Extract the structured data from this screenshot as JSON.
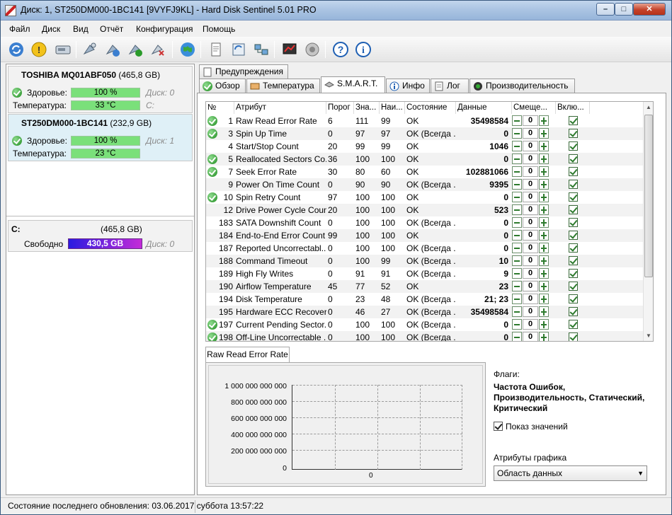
{
  "window": {
    "title": "Диск: 1, ST250DM000-1BC141 [9VYFJ9KL]  -  Hard Disk Sentinel 5.01 PRO",
    "min": "–",
    "max": "□",
    "close": "✕"
  },
  "menu": [
    "Файл",
    "Диск",
    "Вид",
    "Отчёт",
    "Конфигурация",
    "Помощь"
  ],
  "toolbar": [
    {
      "icon": "refresh-icon"
    },
    {
      "icon": "warning-icon"
    },
    {
      "icon": "drive-icon"
    },
    {
      "icon": "satellite-icon"
    },
    {
      "icon": "satellite-refresh-icon"
    },
    {
      "icon": "satellite-check-icon"
    },
    {
      "icon": "satellite-x-icon"
    },
    {
      "icon": "globe-icon"
    },
    {
      "icon": "report-icon"
    },
    {
      "icon": "sync-icon"
    },
    {
      "icon": "network-icon"
    },
    {
      "icon": "chart-icon"
    },
    {
      "icon": "speaker-icon"
    },
    {
      "icon": "help-icon"
    },
    {
      "icon": "info-icon"
    }
  ],
  "disks": [
    {
      "model": "TOSHIBA MQ01ABF050",
      "size": "(465,8 GB)",
      "health_label": "Здоровье:",
      "health": "100 %",
      "health_note": "Диск: 0",
      "temp_label": "Температура:",
      "temp": "33 °C",
      "temp_note": "C:"
    },
    {
      "model": "ST250DM000-1BC141",
      "size": "(232,9 GB)",
      "health_label": "Здоровье:",
      "health": "100 %",
      "health_note": "Диск: 1",
      "temp_label": "Температура:",
      "temp": "23 °C",
      "temp_note": ""
    }
  ],
  "volume": {
    "name": "C:",
    "size": "(465,8 GB)",
    "free_label": "Свободно",
    "free": "430,5 GB",
    "note": "Диск: 0"
  },
  "tabs_top": [
    {
      "label": "Предупреждения"
    }
  ],
  "tabs": [
    {
      "label": "Обзор",
      "icon": "check-icon"
    },
    {
      "label": "Температура",
      "icon": "thermometer-icon"
    },
    {
      "label": "S.M.A.R.T.",
      "icon": "smart-icon"
    },
    {
      "label": "Инфо",
      "icon": "info-icon"
    },
    {
      "label": "Лог",
      "icon": "log-icon"
    },
    {
      "label": "Производительность",
      "icon": "gauge-icon"
    }
  ],
  "smart": {
    "columns": [
      "№",
      "Атрибут",
      "Порог",
      "Зна...",
      "Наи...",
      "Состояние",
      "Данные",
      "Смеще...",
      "Вклю..."
    ],
    "rows": [
      {
        "ok": true,
        "num": "1",
        "attr": "Raw Read Error Rate",
        "thr": "6",
        "val": "111",
        "worst": "99",
        "state": "OK",
        "data": "35498584",
        "offset": "0"
      },
      {
        "ok": true,
        "num": "3",
        "attr": "Spin Up Time",
        "thr": "0",
        "val": "97",
        "worst": "97",
        "state": "OK (Всегда ...",
        "data": "0",
        "offset": "0"
      },
      {
        "ok": false,
        "num": "4",
        "attr": "Start/Stop Count",
        "thr": "20",
        "val": "99",
        "worst": "99",
        "state": "OK",
        "data": "1046",
        "offset": "0"
      },
      {
        "ok": true,
        "num": "5",
        "attr": "Reallocated Sectors Co...",
        "thr": "36",
        "val": "100",
        "worst": "100",
        "state": "OK",
        "data": "0",
        "offset": "0"
      },
      {
        "ok": true,
        "num": "7",
        "attr": "Seek Error Rate",
        "thr": "30",
        "val": "80",
        "worst": "60",
        "state": "OK",
        "data": "102881066",
        "offset": "0"
      },
      {
        "ok": false,
        "num": "9",
        "attr": "Power On Time Count",
        "thr": "0",
        "val": "90",
        "worst": "90",
        "state": "OK (Всегда ...",
        "data": "9395",
        "offset": "0"
      },
      {
        "ok": true,
        "num": "10",
        "attr": "Spin Retry Count",
        "thr": "97",
        "val": "100",
        "worst": "100",
        "state": "OK",
        "data": "0",
        "offset": "0"
      },
      {
        "ok": false,
        "num": "12",
        "attr": "Drive Power Cycle Count",
        "thr": "20",
        "val": "100",
        "worst": "100",
        "state": "OK",
        "data": "523",
        "offset": "0"
      },
      {
        "ok": false,
        "num": "183",
        "attr": "SATA Downshift Count",
        "thr": "0",
        "val": "100",
        "worst": "100",
        "state": "OK (Всегда ...",
        "data": "0",
        "offset": "0"
      },
      {
        "ok": false,
        "num": "184",
        "attr": "End-to-End Error Count",
        "thr": "99",
        "val": "100",
        "worst": "100",
        "state": "OK",
        "data": "0",
        "offset": "0"
      },
      {
        "ok": false,
        "num": "187",
        "attr": "Reported Uncorrectabl...",
        "thr": "0",
        "val": "100",
        "worst": "100",
        "state": "OK (Всегда ...",
        "data": "0",
        "offset": "0"
      },
      {
        "ok": false,
        "num": "188",
        "attr": "Command Timeout",
        "thr": "0",
        "val": "100",
        "worst": "99",
        "state": "OK (Всегда ...",
        "data": "10",
        "offset": "0"
      },
      {
        "ok": false,
        "num": "189",
        "attr": "High Fly Writes",
        "thr": "0",
        "val": "91",
        "worst": "91",
        "state": "OK (Всегда ...",
        "data": "9",
        "offset": "0"
      },
      {
        "ok": false,
        "num": "190",
        "attr": "Airflow Temperature",
        "thr": "45",
        "val": "77",
        "worst": "52",
        "state": "OK",
        "data": "23",
        "offset": "0"
      },
      {
        "ok": false,
        "num": "194",
        "attr": "Disk Temperature",
        "thr": "0",
        "val": "23",
        "worst": "48",
        "state": "OK (Всегда ...",
        "data": "21; 23",
        "offset": "0"
      },
      {
        "ok": false,
        "num": "195",
        "attr": "Hardware ECC Recovered",
        "thr": "0",
        "val": "46",
        "worst": "27",
        "state": "OK (Всегда ...",
        "data": "35498584",
        "offset": "0"
      },
      {
        "ok": true,
        "num": "197",
        "attr": "Current Pending Sector...",
        "thr": "0",
        "val": "100",
        "worst": "100",
        "state": "OK (Всегда ...",
        "data": "0",
        "offset": "0"
      },
      {
        "ok": true,
        "num": "198",
        "attr": "Off-Line Uncorrectable ...",
        "thr": "0",
        "val": "100",
        "worst": "100",
        "state": "OK (Всегда ...",
        "data": "0",
        "offset": "0"
      }
    ]
  },
  "graph": {
    "tab_label": "Raw Read Error Rate",
    "y_ticks": [
      "1 000 000 000 000",
      "800 000 000 000",
      "600 000 000 000",
      "400 000 000 000",
      "200 000 000 000",
      "0"
    ],
    "x_tick": "0"
  },
  "flags": {
    "title": "Флаги:",
    "text": "Частота Ошибок, Производительность, Статический, Критический",
    "show_values_label": "Показ значений",
    "graph_attr_label": "Атрибуты графика",
    "graph_attr_value": "Область данных"
  },
  "status": {
    "text": "Состояние последнего обновления: 03.06.2017 суббота 13:57:22"
  }
}
